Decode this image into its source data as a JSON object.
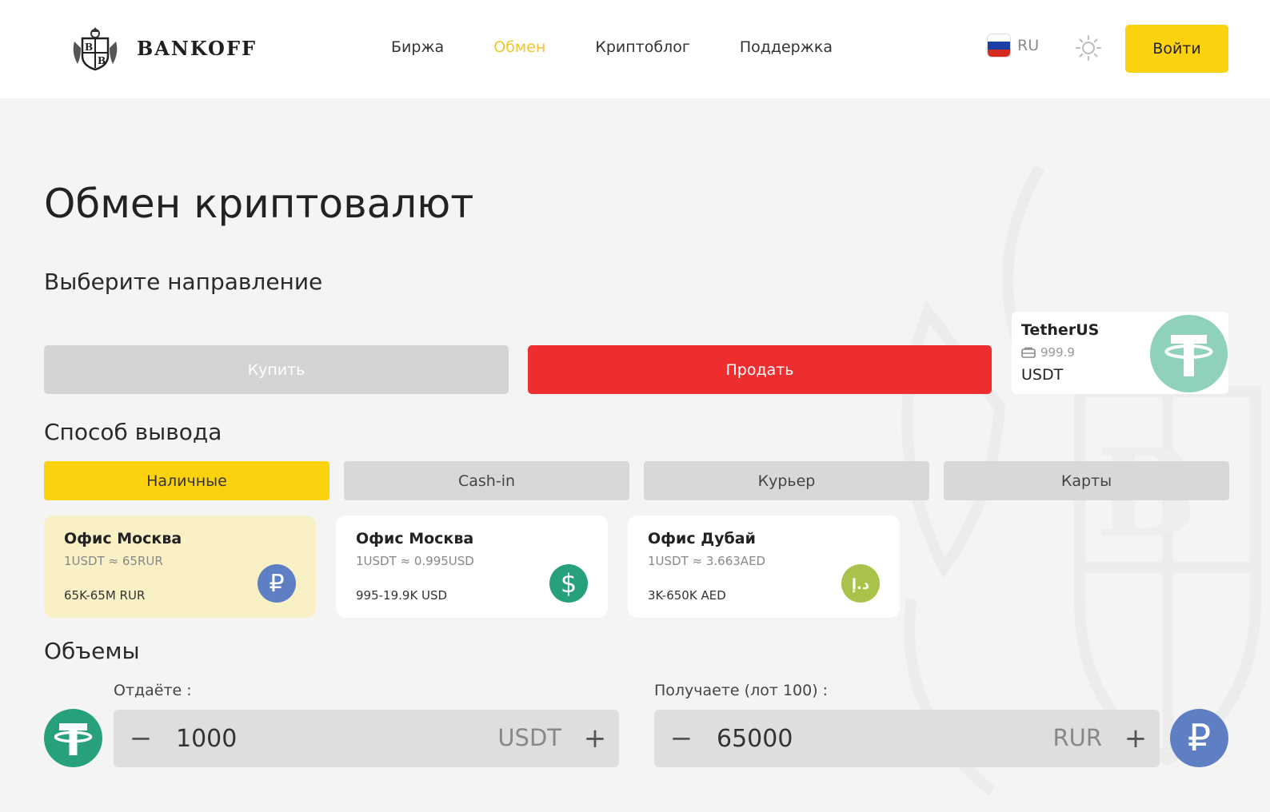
{
  "brand": {
    "name": "BANKOFF"
  },
  "nav": [
    {
      "label": "Биржа",
      "active": false
    },
    {
      "label": "Обмен",
      "active": true
    },
    {
      "label": "Криптоблог",
      "active": false
    },
    {
      "label": "Поддержка",
      "active": false
    }
  ],
  "header": {
    "lang": "RU",
    "login_label": "Войти",
    "theme_icon": "sun-icon"
  },
  "page": {
    "title": "Обмен криптовалют",
    "direction_title": "Выберите направление",
    "buy_label": "Купить",
    "sell_label": "Продать",
    "method_title": "Способ вывода",
    "volumes_title": "Объемы"
  },
  "asset": {
    "name": "TetherUS",
    "balance": "999.9",
    "code": "USDT",
    "icon": "tether-icon"
  },
  "methods": [
    {
      "label": "Наличные",
      "active": true
    },
    {
      "label": "Cash-in",
      "active": false
    },
    {
      "label": "Курьер",
      "active": false
    },
    {
      "label": "Карты",
      "active": false
    }
  ],
  "offices": [
    {
      "name": "Офис Москва",
      "rate": "1USDT ≈ 65RUR",
      "range": "65K-65M RUR",
      "icon": "ruble-icon",
      "selected": true
    },
    {
      "name": "Офис Москва",
      "rate": "1USDT ≈ 0.995USD",
      "range": "995-19.9K USD",
      "icon": "dollar-icon",
      "selected": false
    },
    {
      "name": "Офис Дубай",
      "rate": "1USDT ≈ 3.663AED",
      "range": "3K-650K AED",
      "icon": "dirham-icon",
      "selected": false
    }
  ],
  "give": {
    "label": "Отдаёте :",
    "value": "1000",
    "unit": "USDT"
  },
  "get": {
    "label": "Получаете  (лот 100) :",
    "value": "65000",
    "unit": "RUR"
  },
  "colors": {
    "accent": "#fcd20f",
    "sell": "#ee2e2e",
    "tether": "#26a17b",
    "ruble": "#5f7fc4",
    "dirham": "#a8c24a"
  }
}
